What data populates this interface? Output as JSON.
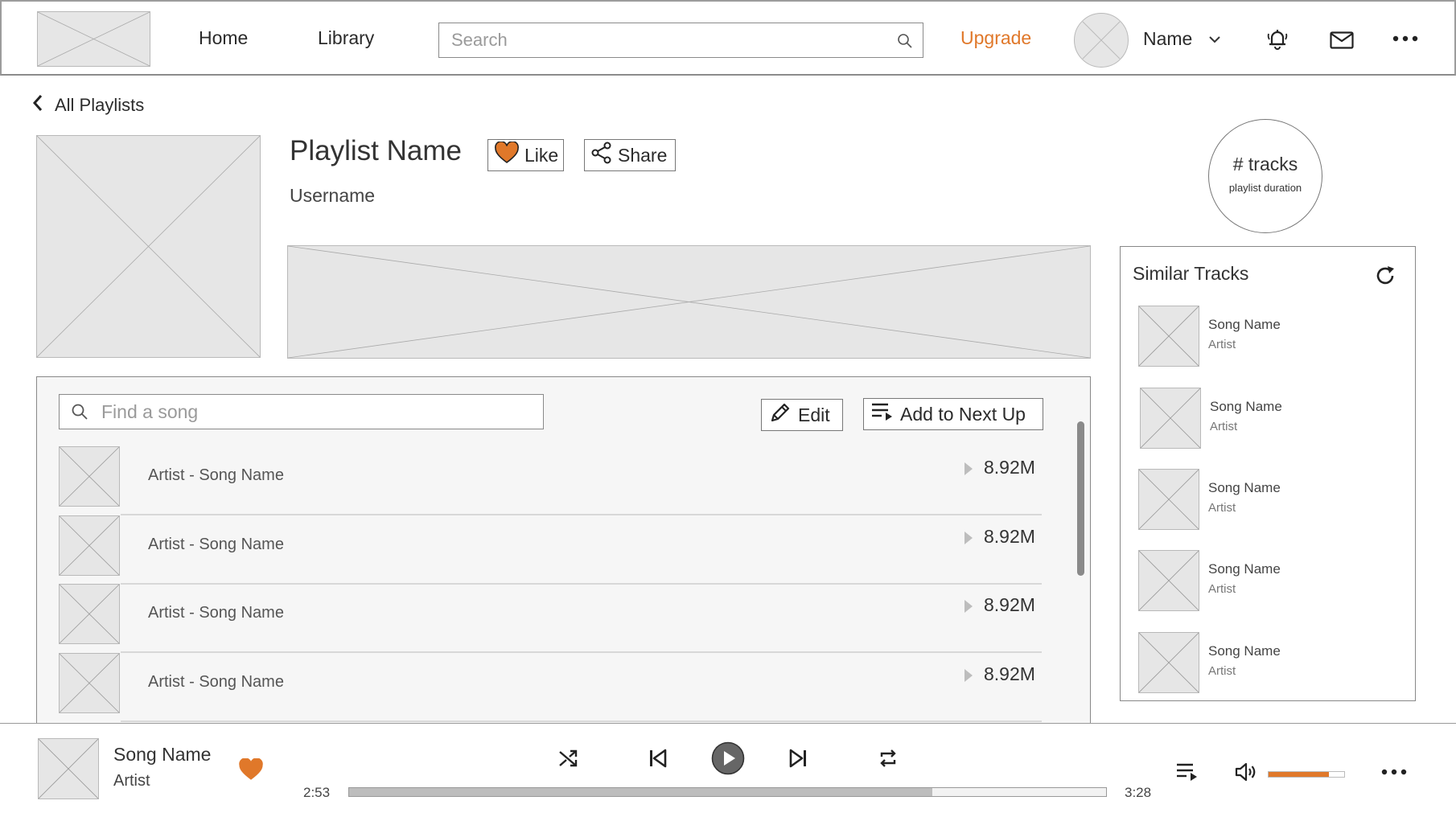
{
  "nav": {
    "home": "Home",
    "library": "Library",
    "search_placeholder": "Search",
    "upgrade": "Upgrade",
    "user_name": "Name"
  },
  "playlist": {
    "back_label": "All Playlists",
    "title": "Playlist Name",
    "owner": "Username",
    "like_label": "Like",
    "share_label": "Share",
    "tracks_count": "# tracks",
    "duration_label": "playlist duration"
  },
  "tracklist": {
    "search_placeholder": "Find a song",
    "edit_label": "Edit",
    "add_next_label": "Add to Next Up",
    "rows": [
      {
        "title": "Artist - Song Name",
        "plays": "8.92M"
      },
      {
        "title": "Artist - Song Name",
        "plays": "8.92M"
      },
      {
        "title": "Artist - Song Name",
        "plays": "8.92M"
      },
      {
        "title": "Artist - Song Name",
        "plays": "8.92M"
      }
    ]
  },
  "similar": {
    "title": "Similar Tracks",
    "items": [
      {
        "song": "Song Name",
        "artist": "Artist"
      },
      {
        "song": "Song Name",
        "artist": "Artist"
      },
      {
        "song": "Song Name",
        "artist": "Artist"
      },
      {
        "song": "Song Name",
        "artist": "Artist"
      },
      {
        "song": "Song Name",
        "artist": "Artist"
      }
    ]
  },
  "player": {
    "song": "Song Name",
    "artist": "Artist",
    "elapsed": "2:53",
    "total": "3:28",
    "progress_fraction": 0.77,
    "volume_fraction": 0.8
  },
  "colors": {
    "accent": "#e0782a",
    "placeholder_bg": "#e6e6e6",
    "placeholder_stroke": "#b9b9b9"
  },
  "icons": {
    "search": "search-icon",
    "notifications": "bell-icon",
    "messages": "mail-icon",
    "more": "more-icon",
    "back": "chevron-left-icon",
    "like": "heart-icon",
    "share": "share-icon",
    "edit": "pencil-icon",
    "queue": "playlist-add-icon",
    "refresh": "refresh-icon",
    "shuffle": "shuffle-icon",
    "previous": "skip-previous-icon",
    "play": "play-icon",
    "next": "skip-next-icon",
    "repeat": "repeat-icon",
    "volume": "volume-icon"
  }
}
